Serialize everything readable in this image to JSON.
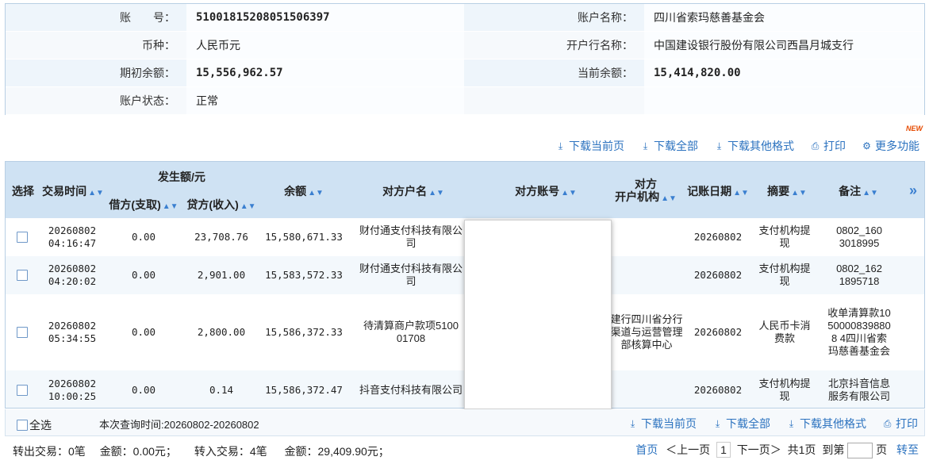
{
  "account": {
    "acct_no_label": "账　　号：",
    "acct_no": "51001815208051506397",
    "acct_name_label": "账户名称：",
    "acct_name": "四川省索玛慈善基金会",
    "currency_label": "币种：",
    "currency": "人民币元",
    "bank_label": "开户行名称：",
    "bank": "中国建设银行股份有限公司西昌月城支行",
    "opening_label": "期初余额：",
    "opening": "15,556,962.57",
    "current_label": "当前余额：",
    "current": "15,414,820.00",
    "status_label": "账户状态：",
    "status": "正常"
  },
  "actions": {
    "download_page": "下载当前页",
    "download_all": "下载全部",
    "download_other": "下载其他格式",
    "print": "打印",
    "more": "更多功能",
    "new_badge": "NEW"
  },
  "table": {
    "headers": {
      "select": "选择",
      "time": "交易时间",
      "amount_group": "发生额/元",
      "debit": "借方(支取)",
      "credit": "贷方(收入)",
      "balance": "余额",
      "cp_name": "对方户名",
      "cp_acct": "对方账号",
      "cp_bank_1": "对方",
      "cp_bank_2": "开户机构",
      "date": "记账日期",
      "summary": "摘要",
      "remark": "备注",
      "more": "»"
    },
    "rows": [
      {
        "date": "20260802",
        "time": "04:16:47",
        "debit": "0.00",
        "credit": "23,708.76",
        "balance": "15,580,671.33",
        "cp_name": "财付通支付科技有限公司",
        "cp_bank": "",
        "post_date": "20260802",
        "summary": "支付机构提现",
        "remark": "0802_1603018995"
      },
      {
        "date": "20260802",
        "time": "04:20:02",
        "debit": "0.00",
        "credit": "2,901.00",
        "balance": "15,583,572.33",
        "cp_name": "财付通支付科技有限公司",
        "cp_bank": "",
        "post_date": "20260802",
        "summary": "支付机构提现",
        "remark": "0802_1621895718"
      },
      {
        "date": "20260802",
        "time": "05:34:55",
        "debit": "0.00",
        "credit": "2,800.00",
        "balance": "15,586,372.33",
        "cp_name": "待清算商户款项510001708",
        "cp_bank": "建行四川省分行渠道与运营管理部核算中心",
        "post_date": "20260802",
        "summary": "人民币卡消费款",
        "remark": "收单清算款10500008398808 4四川省索玛慈善基金会"
      },
      {
        "date": "20260802",
        "time": "10:00:25",
        "debit": "0.00",
        "credit": "0.14",
        "balance": "15,586,372.47",
        "cp_name": "抖音支付科技有限公司",
        "cp_bank": "",
        "post_date": "20260802",
        "summary": "支付机构提现",
        "remark": "北京抖音信息服务有限公司"
      }
    ]
  },
  "footer": {
    "select_all": "全选",
    "query_time": "本次查询时间:20260802-20260802",
    "out_tx": "转出交易：0笔",
    "out_amt": "金额：0.00元；",
    "in_tx": "转入交易：4笔",
    "in_amt": "金额：29,409.90元；",
    "first": "首页",
    "prev": "＜上一页",
    "page": "1",
    "next": "下一页＞",
    "total": "共1页",
    "goto": "到第",
    "page_unit": "页",
    "go": "转至"
  }
}
